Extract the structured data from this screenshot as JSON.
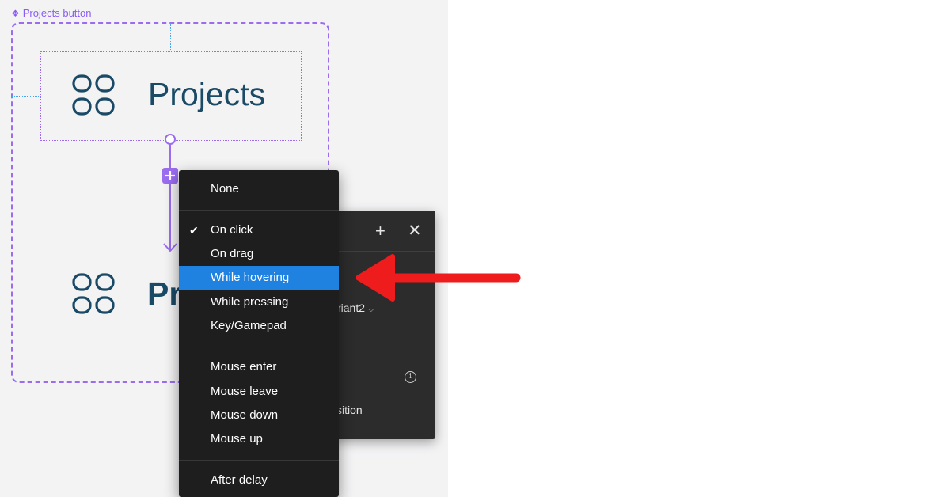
{
  "canvas": {
    "component_label": "Projects button",
    "variant_default": {
      "label": "Projects"
    },
    "variant_hover": {
      "label": "Pr"
    }
  },
  "interaction_panel": {
    "variant_value": "riant2",
    "transition_label": "sition"
  },
  "trigger_menu": {
    "items": [
      {
        "label": "None",
        "checked": false,
        "active": false
      },
      {
        "label": "On click",
        "checked": true,
        "active": false
      },
      {
        "label": "On drag",
        "checked": false,
        "active": false
      },
      {
        "label": "While hovering",
        "checked": false,
        "active": true
      },
      {
        "label": "While pressing",
        "checked": false,
        "active": false
      },
      {
        "label": "Key/Gamepad",
        "checked": false,
        "active": false
      },
      {
        "label": "Mouse enter",
        "checked": false,
        "active": false
      },
      {
        "label": "Mouse leave",
        "checked": false,
        "active": false
      },
      {
        "label": "Mouse down",
        "checked": false,
        "active": false
      },
      {
        "label": "Mouse up",
        "checked": false,
        "active": false
      },
      {
        "label": "After delay",
        "checked": false,
        "active": false
      }
    ]
  },
  "colors": {
    "canvas_bg": "#f3f3f4",
    "component_purple": "#9b6cf0",
    "button_text": "#1a4a66",
    "menu_bg": "#1e1e1e",
    "menu_highlight": "#1f82e0",
    "annotation_arrow": "#ee1c1c"
  }
}
